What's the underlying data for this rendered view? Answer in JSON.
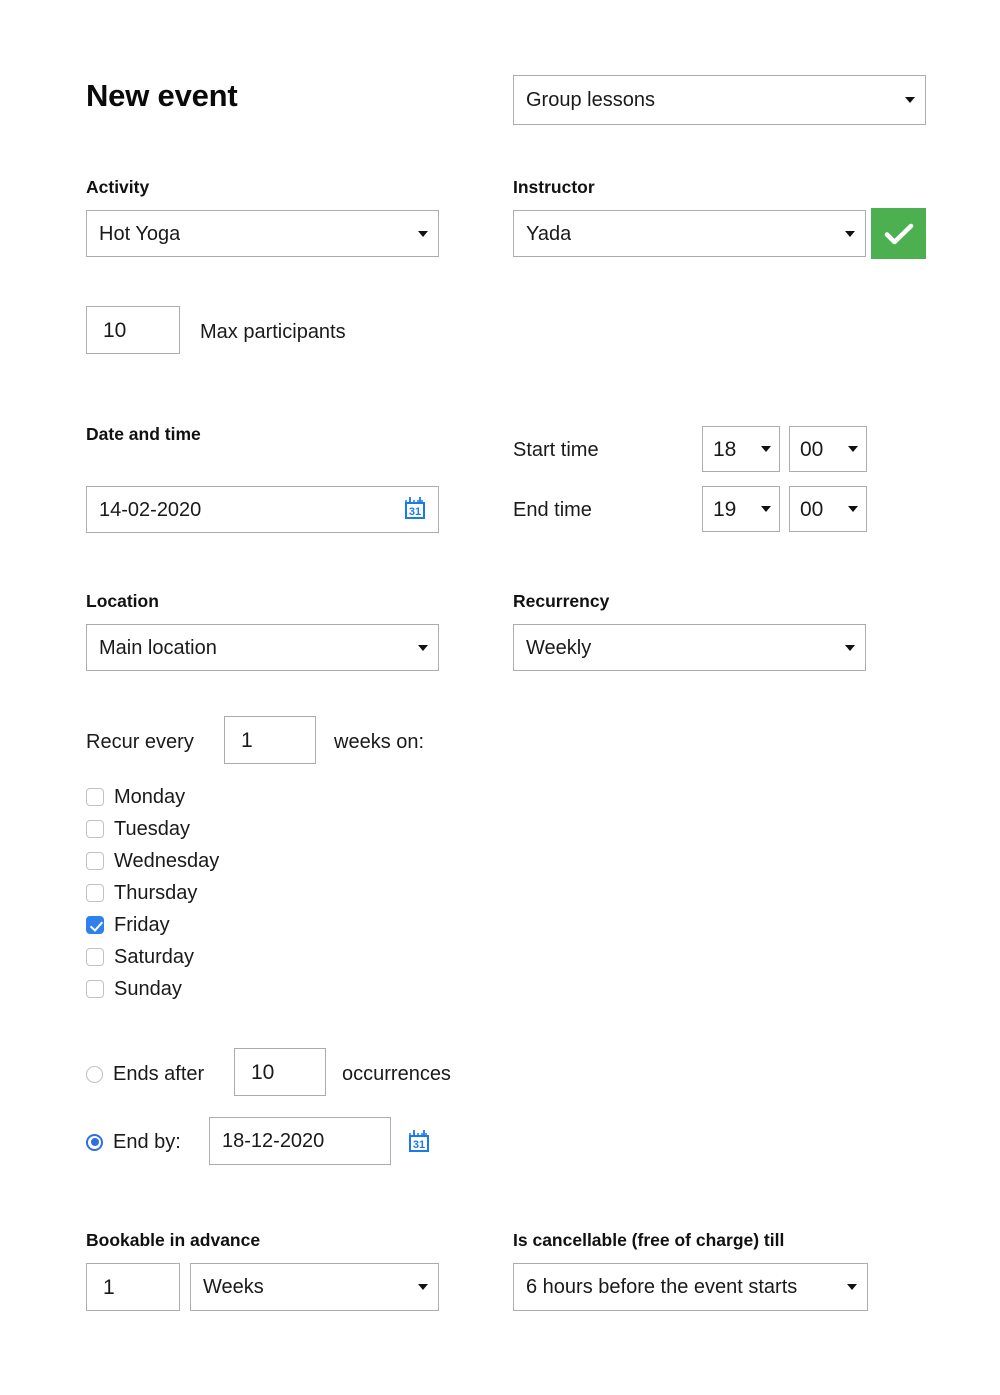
{
  "page": {
    "title": "New event"
  },
  "event_type": {
    "value": "Group lessons",
    "icon": "chevron-down-icon"
  },
  "activity": {
    "label": "Activity",
    "value": "Hot Yoga"
  },
  "instructor": {
    "label": "Instructor",
    "value": "Yada",
    "confirm_icon": "check-icon",
    "confirm_color": "#4cb050"
  },
  "max_participants": {
    "value": "10",
    "label": "Max participants"
  },
  "date_and_time": {
    "label": "Date and time",
    "date_value": "14-02-2020",
    "calendar_icon": "calendar-icon",
    "calendar_icon_text": "31",
    "calendar_icon_color": "#1a7aeb",
    "start_time": {
      "label": "Start time",
      "hours": "18",
      "minutes": "00"
    },
    "end_time": {
      "label": "End time",
      "hours": "19",
      "minutes": "00"
    }
  },
  "location": {
    "label": "Location",
    "value": "Main location"
  },
  "recurrency": {
    "label": "Recurrency",
    "value": "Weekly"
  },
  "recur_every": {
    "prefix_label": "Recur every",
    "interval": "1",
    "suffix_label": "weeks on:"
  },
  "weekdays": [
    {
      "label": "Monday",
      "checked": false
    },
    {
      "label": "Tuesday",
      "checked": false
    },
    {
      "label": "Wednesday",
      "checked": false
    },
    {
      "label": "Thursday",
      "checked": false
    },
    {
      "label": "Friday",
      "checked": true
    },
    {
      "label": "Saturday",
      "checked": false
    },
    {
      "label": "Sunday",
      "checked": false
    }
  ],
  "checkbox_checked_color": "#2f80ed",
  "radio_selected_color": "#2f6fe0",
  "ends_after": {
    "label": "Ends after",
    "occurrences": "10",
    "suffix_label": "occurrences",
    "selected": false
  },
  "end_by": {
    "label": "End by:",
    "date_value": "18-12-2020",
    "calendar_icon": "calendar-icon",
    "calendar_icon_text": "31",
    "selected": true
  },
  "bookable_in_advance": {
    "label": "Bookable in advance",
    "amount": "1",
    "unit": "Weeks"
  },
  "cancellable": {
    "label": "Is cancellable (free of charge) till",
    "value": "6 hours before the event starts"
  }
}
